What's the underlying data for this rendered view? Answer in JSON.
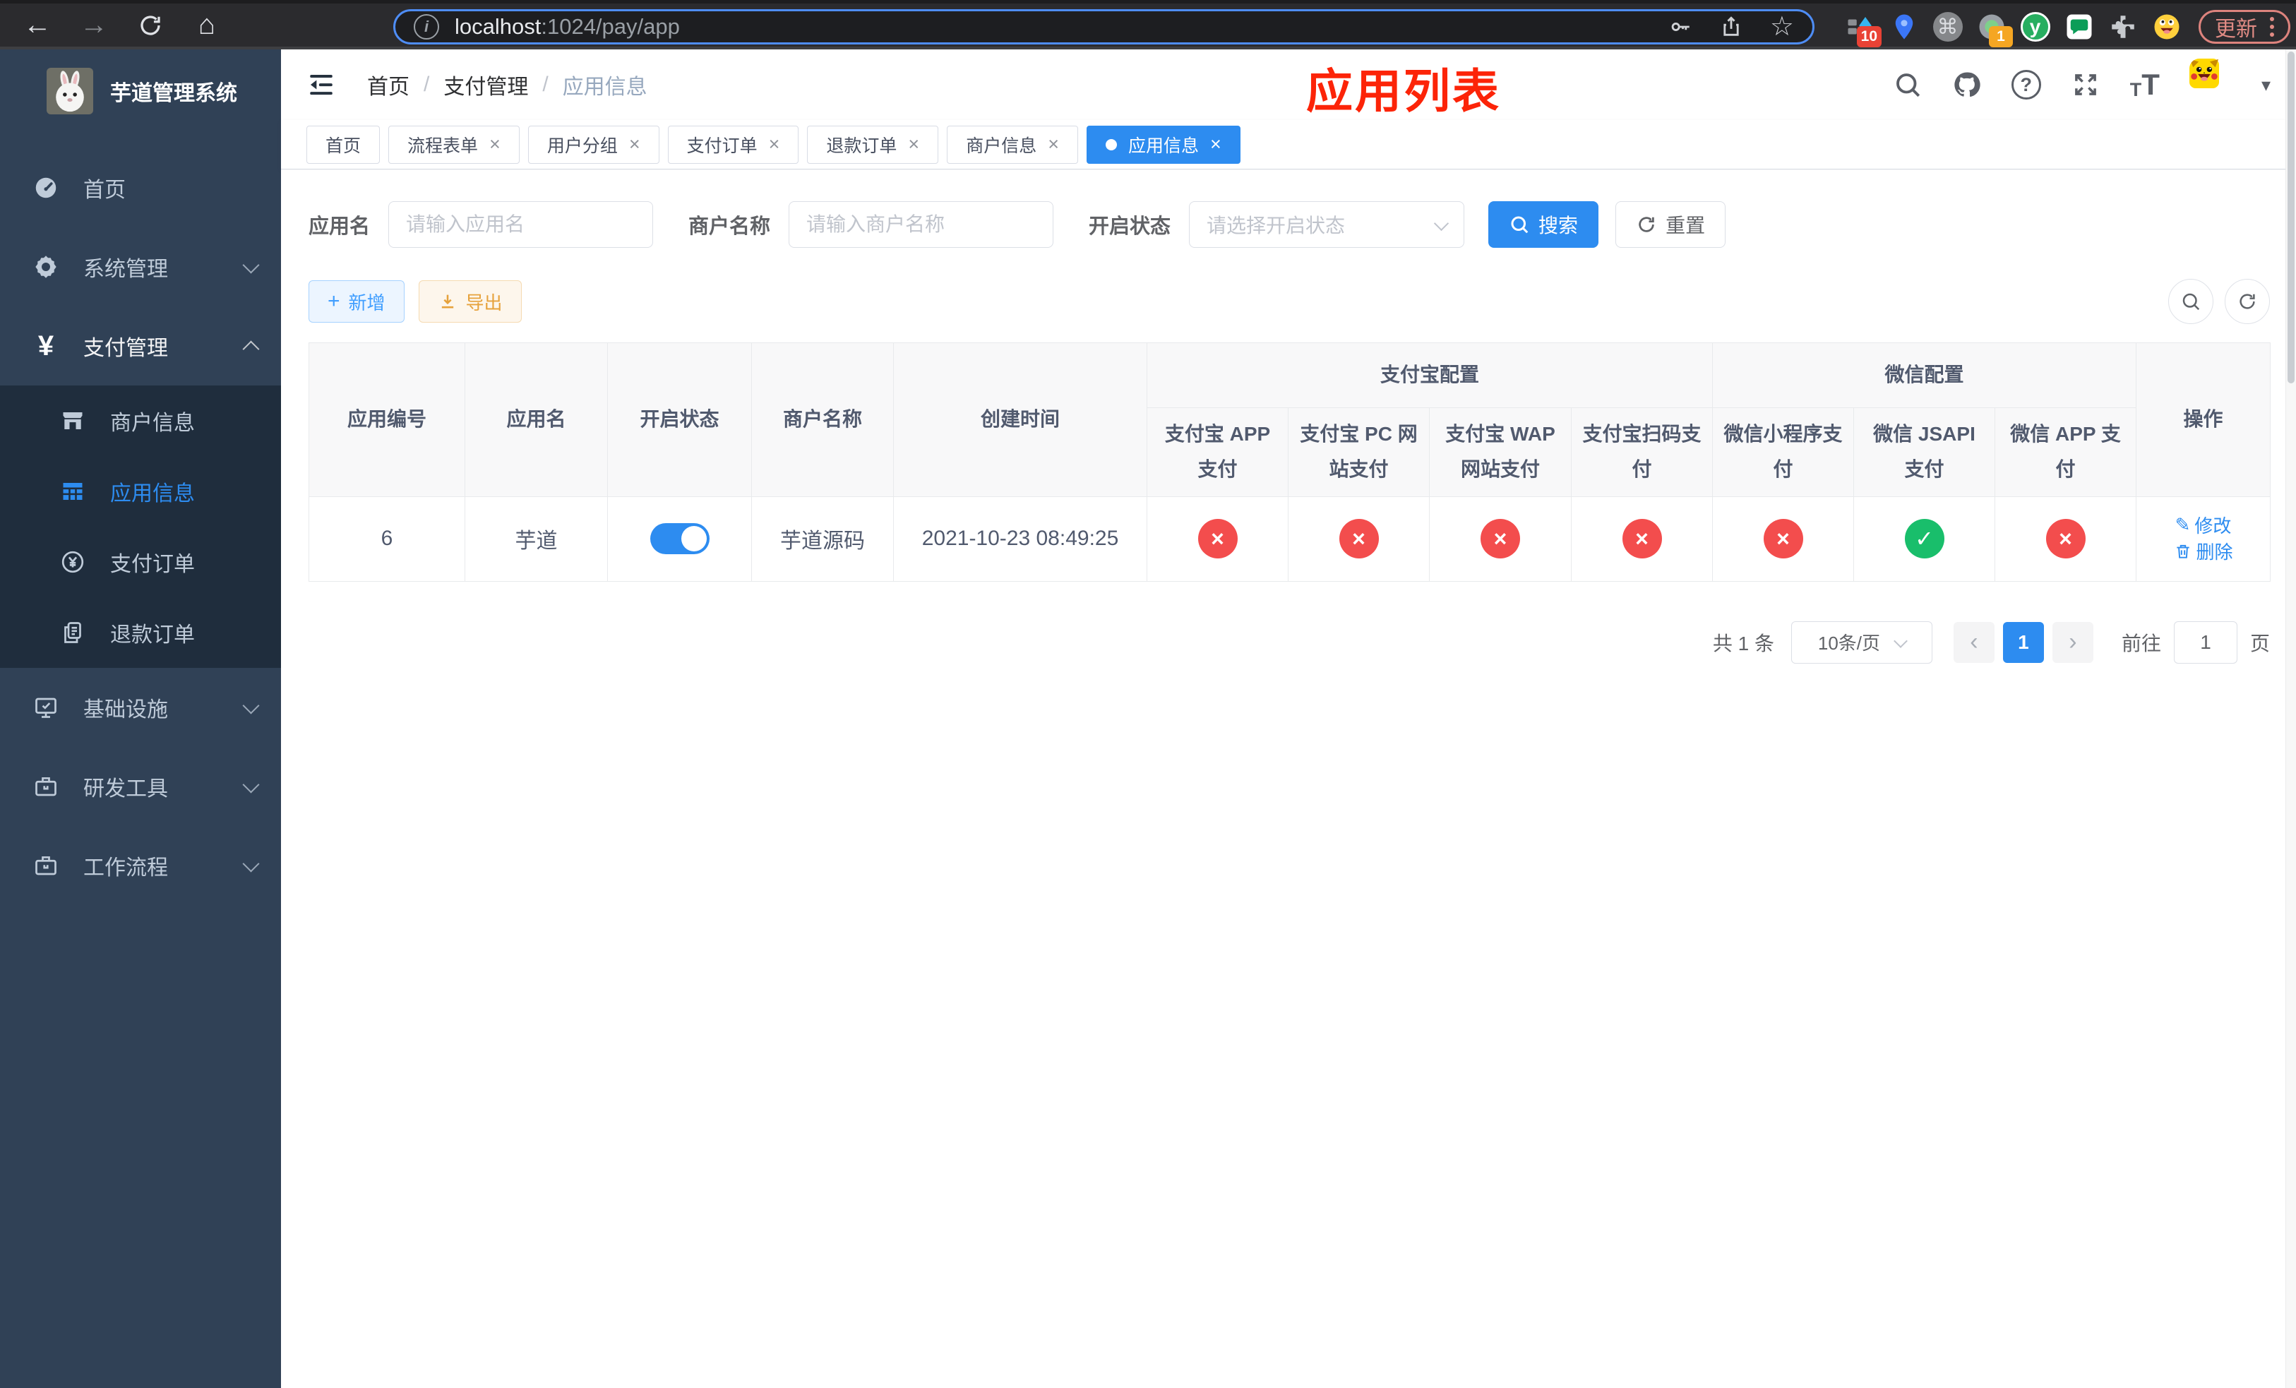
{
  "colors": {
    "accent": "#2d8cf0",
    "sidebar_bg": "#304156",
    "submenu_bg": "#1f2d3d",
    "status_off_red": "#f34d4d",
    "status_on_green": "#19be6b",
    "export_orange": "#e6a23c",
    "annotation_red": "#fc2408"
  },
  "icons": {
    "back": "←",
    "forward": "→",
    "home": "⌂",
    "info": "i",
    "star": "☆",
    "command": "⌘",
    "yen": "¥",
    "check": "✓",
    "cross": "×",
    "plus": "+",
    "caret_down": "▾",
    "edit": "✎",
    "question": "?",
    "font_small": "T",
    "font_large": "T",
    "prev_arrow": "‹",
    "next_arrow": "›"
  },
  "browser": {
    "url_host": "localhost",
    "url_rest": ":1024/pay/app",
    "ext_badge_sketch": "10",
    "ext_badge_record": "1",
    "ext_y_label": "y",
    "update_label": "更新"
  },
  "sidebar": {
    "logo_title": "芋道管理系统",
    "items": {
      "home": "首页",
      "system": "系统管理",
      "payment": "支付管理",
      "merchant": "商户信息",
      "app": "应用信息",
      "pay_order": "支付订单",
      "refund_order": "退款订单",
      "infra": "基础设施",
      "devtools": "研发工具",
      "workflow": "工作流程"
    }
  },
  "topbar": {
    "breadcrumb": [
      "首页",
      "支付管理",
      "应用信息"
    ],
    "separator": "/",
    "annotation": "应用列表"
  },
  "tabs": [
    {
      "label": "首页",
      "closable": false,
      "active": false
    },
    {
      "label": "流程表单",
      "closable": true,
      "active": false
    },
    {
      "label": "用户分组",
      "closable": true,
      "active": false
    },
    {
      "label": "支付订单",
      "closable": true,
      "active": false
    },
    {
      "label": "退款订单",
      "closable": true,
      "active": false
    },
    {
      "label": "商户信息",
      "closable": true,
      "active": false
    },
    {
      "label": "应用信息",
      "closable": true,
      "active": true
    }
  ],
  "filters": {
    "app_name_label": "应用名",
    "app_name_placeholder": "请输入应用名",
    "merchant_label": "商户名称",
    "merchant_placeholder": "请输入商户名称",
    "status_label": "开启状态",
    "status_placeholder": "请选择开启状态",
    "search_label": "搜索",
    "reset_label": "重置"
  },
  "toolbar": {
    "add_label": "新增",
    "export_label": "导出"
  },
  "table": {
    "row_headers": [
      "应用编号",
      "应用名",
      "开启状态",
      "商户名称",
      "创建时间"
    ],
    "groups": [
      {
        "label": "支付宝配置",
        "span": 4
      },
      {
        "label": "微信配置",
        "span": 3
      }
    ],
    "leaf_headers": [
      "支付宝 APP 支付",
      "支付宝 PC 网站支付",
      "支付宝 WAP 网站支付",
      "支付宝扫码支付",
      "微信小程序支付",
      "微信 JSAPI 支付",
      "微信 APP 支付"
    ],
    "ops_header": "操作",
    "row": {
      "app_id": "6",
      "app_name": "芋道",
      "enabled": true,
      "merchant_name": "芋道源码",
      "create_time": "2021-10-23 08:49:25",
      "pay_channels": [
        false,
        false,
        false,
        false,
        false,
        true,
        false
      ],
      "edit_label": "修改",
      "delete_label": "删除"
    }
  },
  "pagination": {
    "total": "共 1 条",
    "page_size": "10条/页",
    "current": "1",
    "goto_label": "前往",
    "goto_value": "1",
    "unit": "页"
  }
}
